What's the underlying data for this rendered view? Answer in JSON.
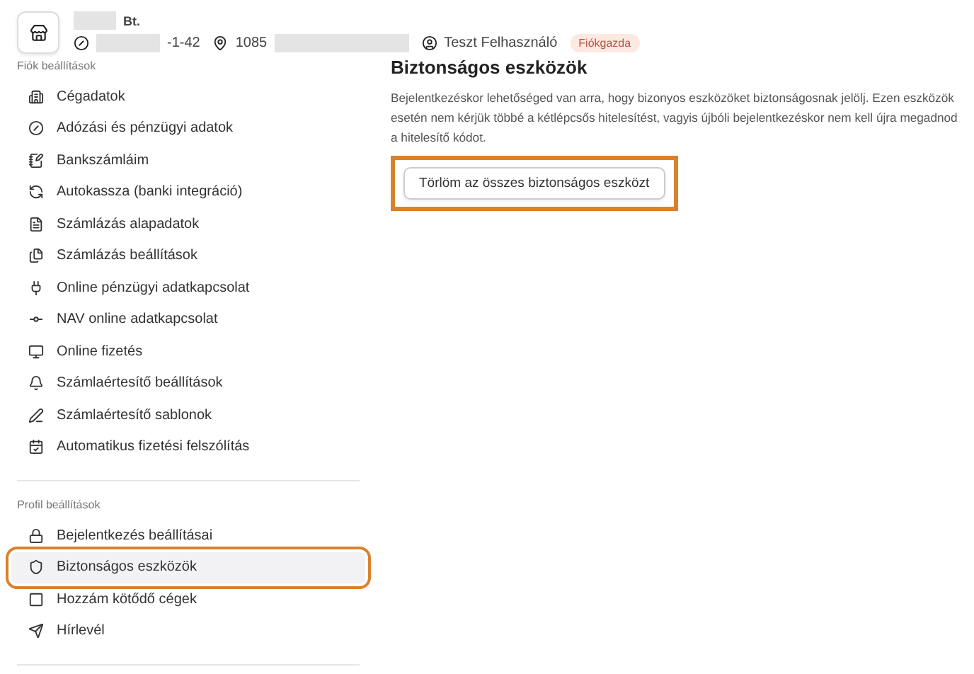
{
  "header": {
    "company_suffix": "Bt.",
    "tax_id_suffix": "-1-42",
    "address_prefix": "1085",
    "user": "Teszt Felhasználó",
    "role_badge": "Fiókgazda"
  },
  "sidebar": {
    "sections": [
      {
        "title": "Fiók beállítások",
        "items": [
          {
            "label": "Cégadatok",
            "selected": false,
            "highlighted": false
          },
          {
            "label": "Adózási és pénzügyi adatok",
            "selected": false,
            "highlighted": false
          },
          {
            "label": "Bankszámláim",
            "selected": false,
            "highlighted": false
          },
          {
            "label": "Autokassza (banki integráció)",
            "selected": false,
            "highlighted": false
          },
          {
            "label": "Számlázás alapadatok",
            "selected": false,
            "highlighted": false
          },
          {
            "label": "Számlázás beállítások",
            "selected": false,
            "highlighted": false
          },
          {
            "label": "Online pénzügyi adatkapcsolat",
            "selected": false,
            "highlighted": false
          },
          {
            "label": "NAV online adatkapcsolat",
            "selected": false,
            "highlighted": false
          },
          {
            "label": "Online fizetés",
            "selected": false,
            "highlighted": false
          },
          {
            "label": "Számlaértesítő beállítások",
            "selected": false,
            "highlighted": false
          },
          {
            "label": "Számlaértesítő sablonok",
            "selected": false,
            "highlighted": false
          },
          {
            "label": "Automatikus fizetési felszólítás",
            "selected": false,
            "highlighted": false
          }
        ]
      },
      {
        "title": "Profil beállítások",
        "items": [
          {
            "label": "Bejelentkezés beállításai",
            "selected": false,
            "highlighted": false
          },
          {
            "label": "Biztonságos eszközök",
            "selected": true,
            "highlighted": true
          },
          {
            "label": "Hozzám kötődő cégek",
            "selected": false,
            "highlighted": false
          },
          {
            "label": "Hírlevél",
            "selected": false,
            "highlighted": false
          }
        ]
      }
    ]
  },
  "content": {
    "title": "Biztonságos eszközök",
    "description": "Bejelentkezéskor lehetőséged van arra, hogy bizonyos eszközöket biztonságosnak jelölj. Ezen eszközök esetén nem kérjük többé a kétlépcsős hitelesítést, vagyis újbóli bejelentkezéskor nem kell újra megadnod a hitelesítő kódot.",
    "button": {
      "label": "Törlöm az összes biztonságos eszközt",
      "highlighted": true
    }
  }
}
